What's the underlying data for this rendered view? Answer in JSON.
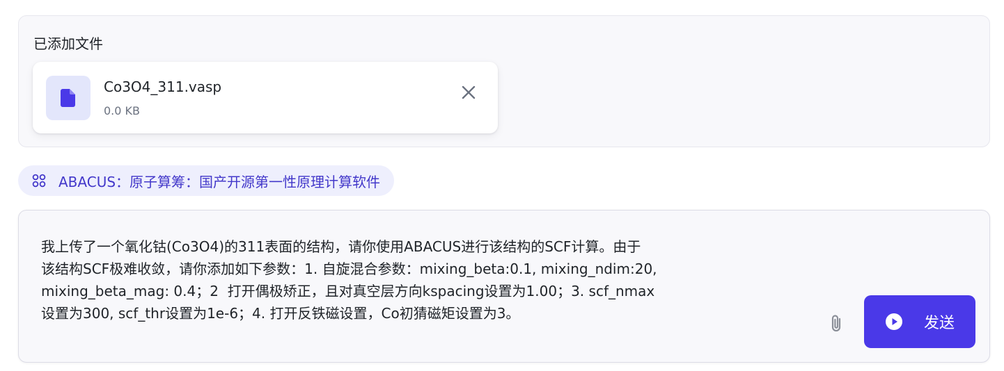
{
  "files_panel": {
    "title": "已添加文件",
    "files": [
      {
        "name": "Co3O4_311.vasp",
        "size": "0.0 KB",
        "icon": "document-icon",
        "remove_icon": "close-icon"
      }
    ]
  },
  "tool_chip": {
    "icon": "apps-grid-icon",
    "label": "ABACUS：原子算筹：国产开源第一性原理计算软件"
  },
  "composer": {
    "text": "我上传了一个氧化钴(Co3O4)的311表面的结构，请你使用ABACUS进行该结构的SCF计算。由于\n该结构SCF极难收敛，请你添加如下参数：1. 自旋混合参数：mixing_beta:0.1, mixing_ndim:20,\nmixing_beta_mag: 0.4；2  打开偶极矫正，且对真空层方向kspacing设置为1.00；3. scf_nmax\n设置为300, scf_thr设置为1e-6；4. 打开反铁磁设置，Co初猜磁矩设置为3。",
    "attach_icon": "paperclip-icon",
    "send_label": "发送",
    "send_icon": "play-circle-icon"
  },
  "colors": {
    "accent": "#4a39e8",
    "chip_bg": "#eeeffd",
    "chip_text": "#4338ca",
    "panel_bg": "#f8f8fb",
    "file_icon_bg": "#e3e6fb"
  }
}
